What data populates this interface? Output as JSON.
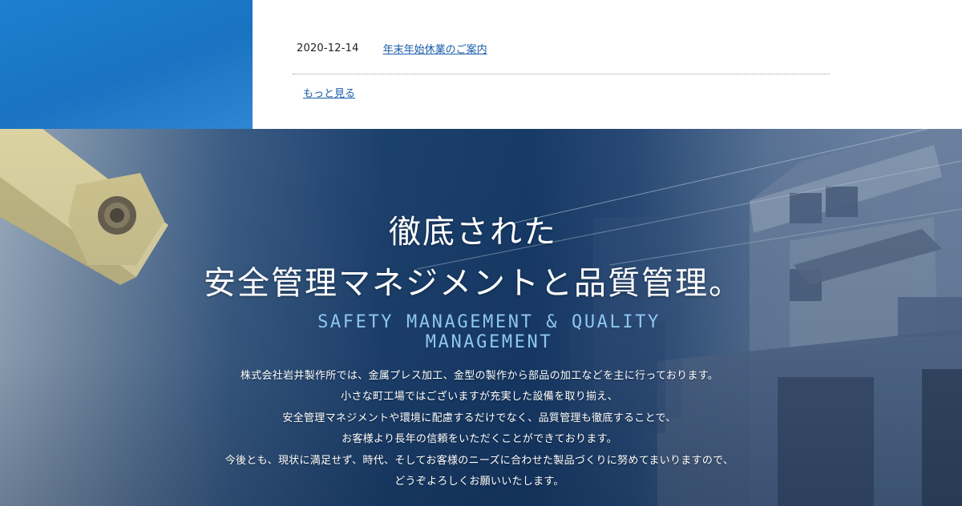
{
  "news": {
    "items": [
      {
        "date": "2020-12-14",
        "title": "年末年始休業のご案内"
      }
    ],
    "more_label": "もっと見る"
  },
  "hero": {
    "title_line1": "徹底された",
    "title_line2": "安全管理マネジメントと品質管理。",
    "subtitle": "SAFETY MANAGEMENT & QUALITY MANAGEMENT",
    "body": [
      "株式会社岩井製作所では、金属プレス加工、金型の製作から部品の加工などを主に行っております。",
      "小さな町工場ではございますが充実した設備を取り揃え、",
      "安全管理マネジメントや環境に配慮するだけでなく、品質管理も徹底することで、",
      "お客様より長年の信頼をいただくことができております。",
      "今後とも、現状に満足せず、時代、そしてお客様のニーズに合わせた製品づくりに努めてまいりますので、",
      "どうぞよろしくお願いいたします。"
    ]
  },
  "colors": {
    "accent_blue": "#1a73c2",
    "link": "#1a5da8",
    "subtitle": "#8ec7ef"
  },
  "icons": [
    "metal-part-image",
    "factory-building-image"
  ]
}
